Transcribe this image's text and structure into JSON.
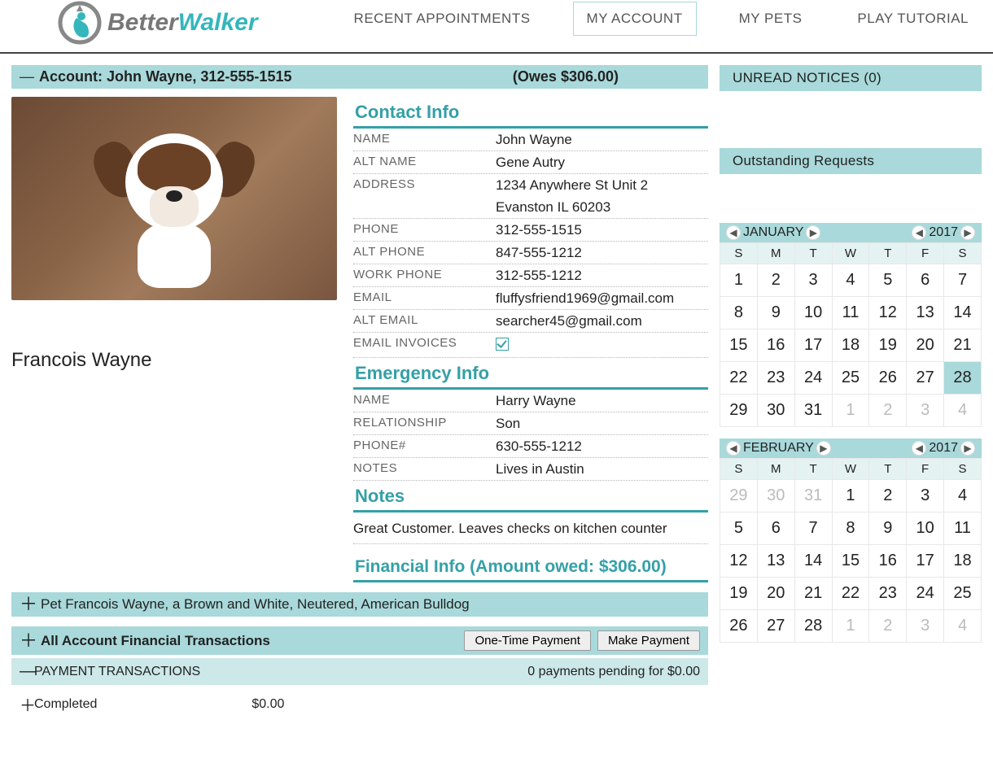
{
  "brand": {
    "part1": "Better",
    "part2": "Walker"
  },
  "nav": {
    "recent": "RECENT APPOINTMENTS",
    "account": "MY ACCOUNT",
    "pets": "MY PETS",
    "tutorial": "PLAY TUTORIAL"
  },
  "account": {
    "banner_prefix": "Account: ",
    "owner": "John Wayne",
    "phone": "312-555-1515",
    "owes": "(Owes $306.00)"
  },
  "pet": {
    "name": "Francois Wayne"
  },
  "contact": {
    "heading": "Contact Info",
    "labels": {
      "name": "NAME",
      "alt_name": "ALT NAME",
      "address": "ADDRESS",
      "phone": "PHONE",
      "alt_phone": "ALT PHONE",
      "work_phone": "WORK PHONE",
      "email": "EMAIL",
      "alt_email": "ALT EMAIL",
      "email_invoices": "EMAIL INVOICES"
    },
    "name": "John Wayne",
    "alt_name": "Gene Autry",
    "address_line1": "1234 Anywhere St Unit 2",
    "address_line2": "Evanston IL 60203",
    "phone": "312-555-1515",
    "alt_phone": "847-555-1212",
    "work_phone": "312-555-1212",
    "email": "fluffysfriend1969@gmail.com",
    "alt_email": "searcher45@gmail.com",
    "email_invoices_checked": true
  },
  "emergency": {
    "heading": "Emergency Info",
    "labels": {
      "name": "NAME",
      "relationship": "RELATIONSHIP",
      "phone": "PHONE#",
      "notes": "NOTES"
    },
    "name": "Harry Wayne",
    "relationship": "Son",
    "phone": "630-555-1212",
    "notes": "Lives in Austin"
  },
  "notes": {
    "heading": "Notes",
    "text": "Great Customer. Leaves checks on kitchen counter"
  },
  "financial": {
    "heading": "Financial Info (Amount owed: $306.00)",
    "pet_panel": "Pet Francois Wayne, a Brown and White, Neutered, American Bulldog",
    "all_trans": "All Account Financial Transactions",
    "one_time_btn": "One-Time Payment",
    "make_payment_btn": "Make Payment",
    "payment_trans": "PAYMENT TRANSACTIONS",
    "pending": "0 payments pending for $0.00",
    "completed_label": "Completed",
    "completed_amt": "$0.00"
  },
  "sidebar": {
    "unread": "UNREAD NOTICES (0)",
    "outstanding": "Outstanding Requests"
  },
  "cal1": {
    "month": "JANUARY",
    "year": "2017",
    "dow": [
      "S",
      "M",
      "T",
      "W",
      "T",
      "F",
      "S"
    ],
    "rows": [
      [
        {
          "d": "1"
        },
        {
          "d": "2"
        },
        {
          "d": "3"
        },
        {
          "d": "4"
        },
        {
          "d": "5"
        },
        {
          "d": "6"
        },
        {
          "d": "7"
        }
      ],
      [
        {
          "d": "8"
        },
        {
          "d": "9"
        },
        {
          "d": "10"
        },
        {
          "d": "11"
        },
        {
          "d": "12"
        },
        {
          "d": "13"
        },
        {
          "d": "14"
        }
      ],
      [
        {
          "d": "15"
        },
        {
          "d": "16"
        },
        {
          "d": "17"
        },
        {
          "d": "18"
        },
        {
          "d": "19"
        },
        {
          "d": "20"
        },
        {
          "d": "21"
        }
      ],
      [
        {
          "d": "22"
        },
        {
          "d": "23"
        },
        {
          "d": "24"
        },
        {
          "d": "25"
        },
        {
          "d": "26"
        },
        {
          "d": "27"
        },
        {
          "d": "28",
          "sel": true
        }
      ],
      [
        {
          "d": "29"
        },
        {
          "d": "30"
        },
        {
          "d": "31"
        },
        {
          "d": "1",
          "out": true
        },
        {
          "d": "2",
          "out": true
        },
        {
          "d": "3",
          "out": true
        },
        {
          "d": "4",
          "out": true
        }
      ]
    ]
  },
  "cal2": {
    "month": "FEBRUARY",
    "year": "2017",
    "dow": [
      "S",
      "M",
      "T",
      "W",
      "T",
      "F",
      "S"
    ],
    "rows": [
      [
        {
          "d": "29",
          "out": true
        },
        {
          "d": "30",
          "out": true
        },
        {
          "d": "31",
          "out": true
        },
        {
          "d": "1"
        },
        {
          "d": "2"
        },
        {
          "d": "3"
        },
        {
          "d": "4"
        }
      ],
      [
        {
          "d": "5"
        },
        {
          "d": "6"
        },
        {
          "d": "7"
        },
        {
          "d": "8"
        },
        {
          "d": "9"
        },
        {
          "d": "10"
        },
        {
          "d": "11"
        }
      ],
      [
        {
          "d": "12"
        },
        {
          "d": "13"
        },
        {
          "d": "14"
        },
        {
          "d": "15"
        },
        {
          "d": "16"
        },
        {
          "d": "17"
        },
        {
          "d": "18"
        }
      ],
      [
        {
          "d": "19"
        },
        {
          "d": "20"
        },
        {
          "d": "21"
        },
        {
          "d": "22"
        },
        {
          "d": "23"
        },
        {
          "d": "24"
        },
        {
          "d": "25"
        }
      ],
      [
        {
          "d": "26"
        },
        {
          "d": "27"
        },
        {
          "d": "28"
        },
        {
          "d": "1",
          "out": true
        },
        {
          "d": "2",
          "out": true
        },
        {
          "d": "3",
          "out": true
        },
        {
          "d": "4",
          "out": true
        }
      ]
    ]
  }
}
